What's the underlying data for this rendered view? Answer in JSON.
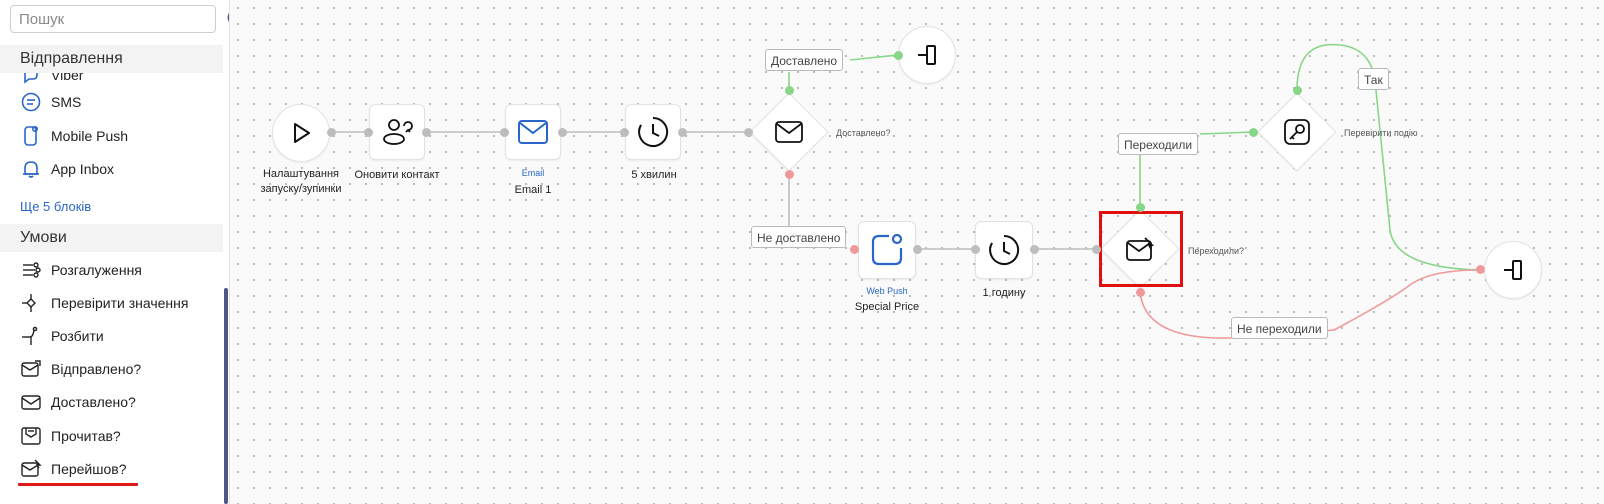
{
  "sidebar": {
    "search_placeholder": "Пошук",
    "section_send": "Відправлення",
    "send_items": [
      {
        "label": "Viber",
        "icon": "viber-icon"
      },
      {
        "label": "SMS",
        "icon": "sms-icon"
      },
      {
        "label": "Mobile Push",
        "icon": "mobile-push-icon"
      },
      {
        "label": "App Inbox",
        "icon": "bell-icon"
      }
    ],
    "more_blocks": "Ще 5 блоків",
    "section_conditions": "Умови",
    "condition_items": [
      {
        "label": "Розгалуження",
        "icon": "branching-icon"
      },
      {
        "label": "Перевірити значення",
        "icon": "check-value-icon"
      },
      {
        "label": "Розбити",
        "icon": "split-icon"
      },
      {
        "label": "Відправлено?",
        "icon": "mail-sent-icon"
      },
      {
        "label": "Доставлено?",
        "icon": "mail-delivered-icon"
      },
      {
        "label": "Прочитав?",
        "icon": "mail-read-icon"
      },
      {
        "label": "Перейшов?",
        "icon": "mail-clicked-icon"
      }
    ]
  },
  "flow": {
    "start": {
      "label": "Налаштування запуску/зупинки"
    },
    "update_contact": {
      "label": "Оновити контакт"
    },
    "email": {
      "type": "Email",
      "label": "Email 1"
    },
    "wait_5": {
      "label": "5 хвилин"
    },
    "delivered_check": {
      "label": "Доставлено?"
    },
    "branch_delivered": "Доставлено",
    "branch_not_delivered": "Не доставлено",
    "webpush": {
      "type": "Web Push",
      "label": "Special Price"
    },
    "wait_1h": {
      "label": "1 годину"
    },
    "clicked_check": {
      "label": "Переходили?"
    },
    "branch_clicked": "Переходили",
    "branch_not_clicked": "Не переходили",
    "event_check": {
      "label": "Перевірити подію"
    },
    "branch_yes": "Так"
  },
  "colors": {
    "accent_blue": "#2a66c8",
    "yes_green": "#88d688",
    "no_red": "#ef9a9a",
    "highlight_red": "#e01010"
  }
}
